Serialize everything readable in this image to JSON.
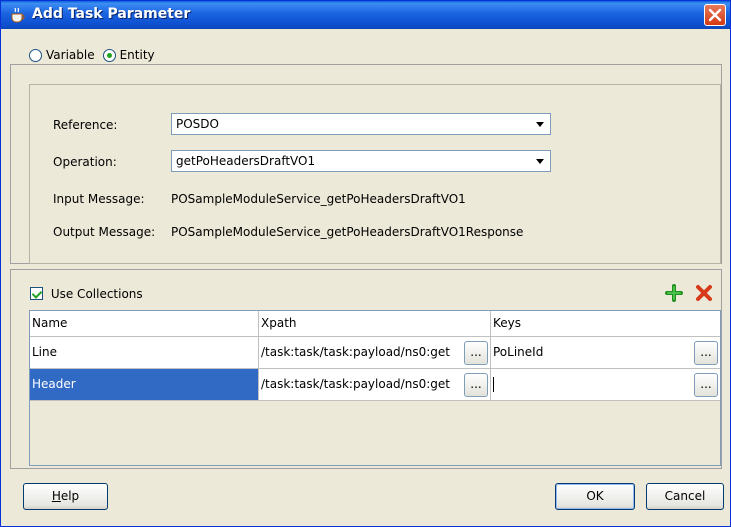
{
  "dialog": {
    "title": "Add Task Parameter",
    "icon": "coffee-cup-icon",
    "close_icon": "close-icon"
  },
  "source_type": {
    "options": [
      "Variable",
      "Entity"
    ],
    "selected": "Entity"
  },
  "form": {
    "reference_label": "Reference:",
    "reference_value": "POSDO",
    "operation_label": "Operation:",
    "operation_value": "getPoHeadersDraftVO1",
    "input_message_label": "Input Message:",
    "input_message_value": "POSampleModuleService_getPoHeadersDraftVO1",
    "output_message_label": "Output Message:",
    "output_message_value": "POSampleModuleService_getPoHeadersDraftVO1Response"
  },
  "collections": {
    "use_label": "Use Collections",
    "checked": true,
    "add_icon": "add-plus-icon",
    "delete_icon": "delete-x-icon",
    "columns": [
      "Name",
      "Xpath",
      "Keys"
    ],
    "rows": [
      {
        "name": "Line",
        "xpath": "/task:task/task:payload/ns0:get",
        "keys": "PoLineId",
        "selected": false
      },
      {
        "name": "Header",
        "xpath": "/task:task/task:payload/ns0:get",
        "keys": "",
        "selected": true
      }
    ],
    "ellipsis": "..."
  },
  "buttons": {
    "help_rest": "elp",
    "help_mnemonic": "H",
    "ok": "OK",
    "cancel": "Cancel"
  },
  "colors": {
    "title_bar": "#1a63e0",
    "selection": "#316ac5",
    "add_icon": "#21a121",
    "delete_icon": "#d63a1a"
  }
}
